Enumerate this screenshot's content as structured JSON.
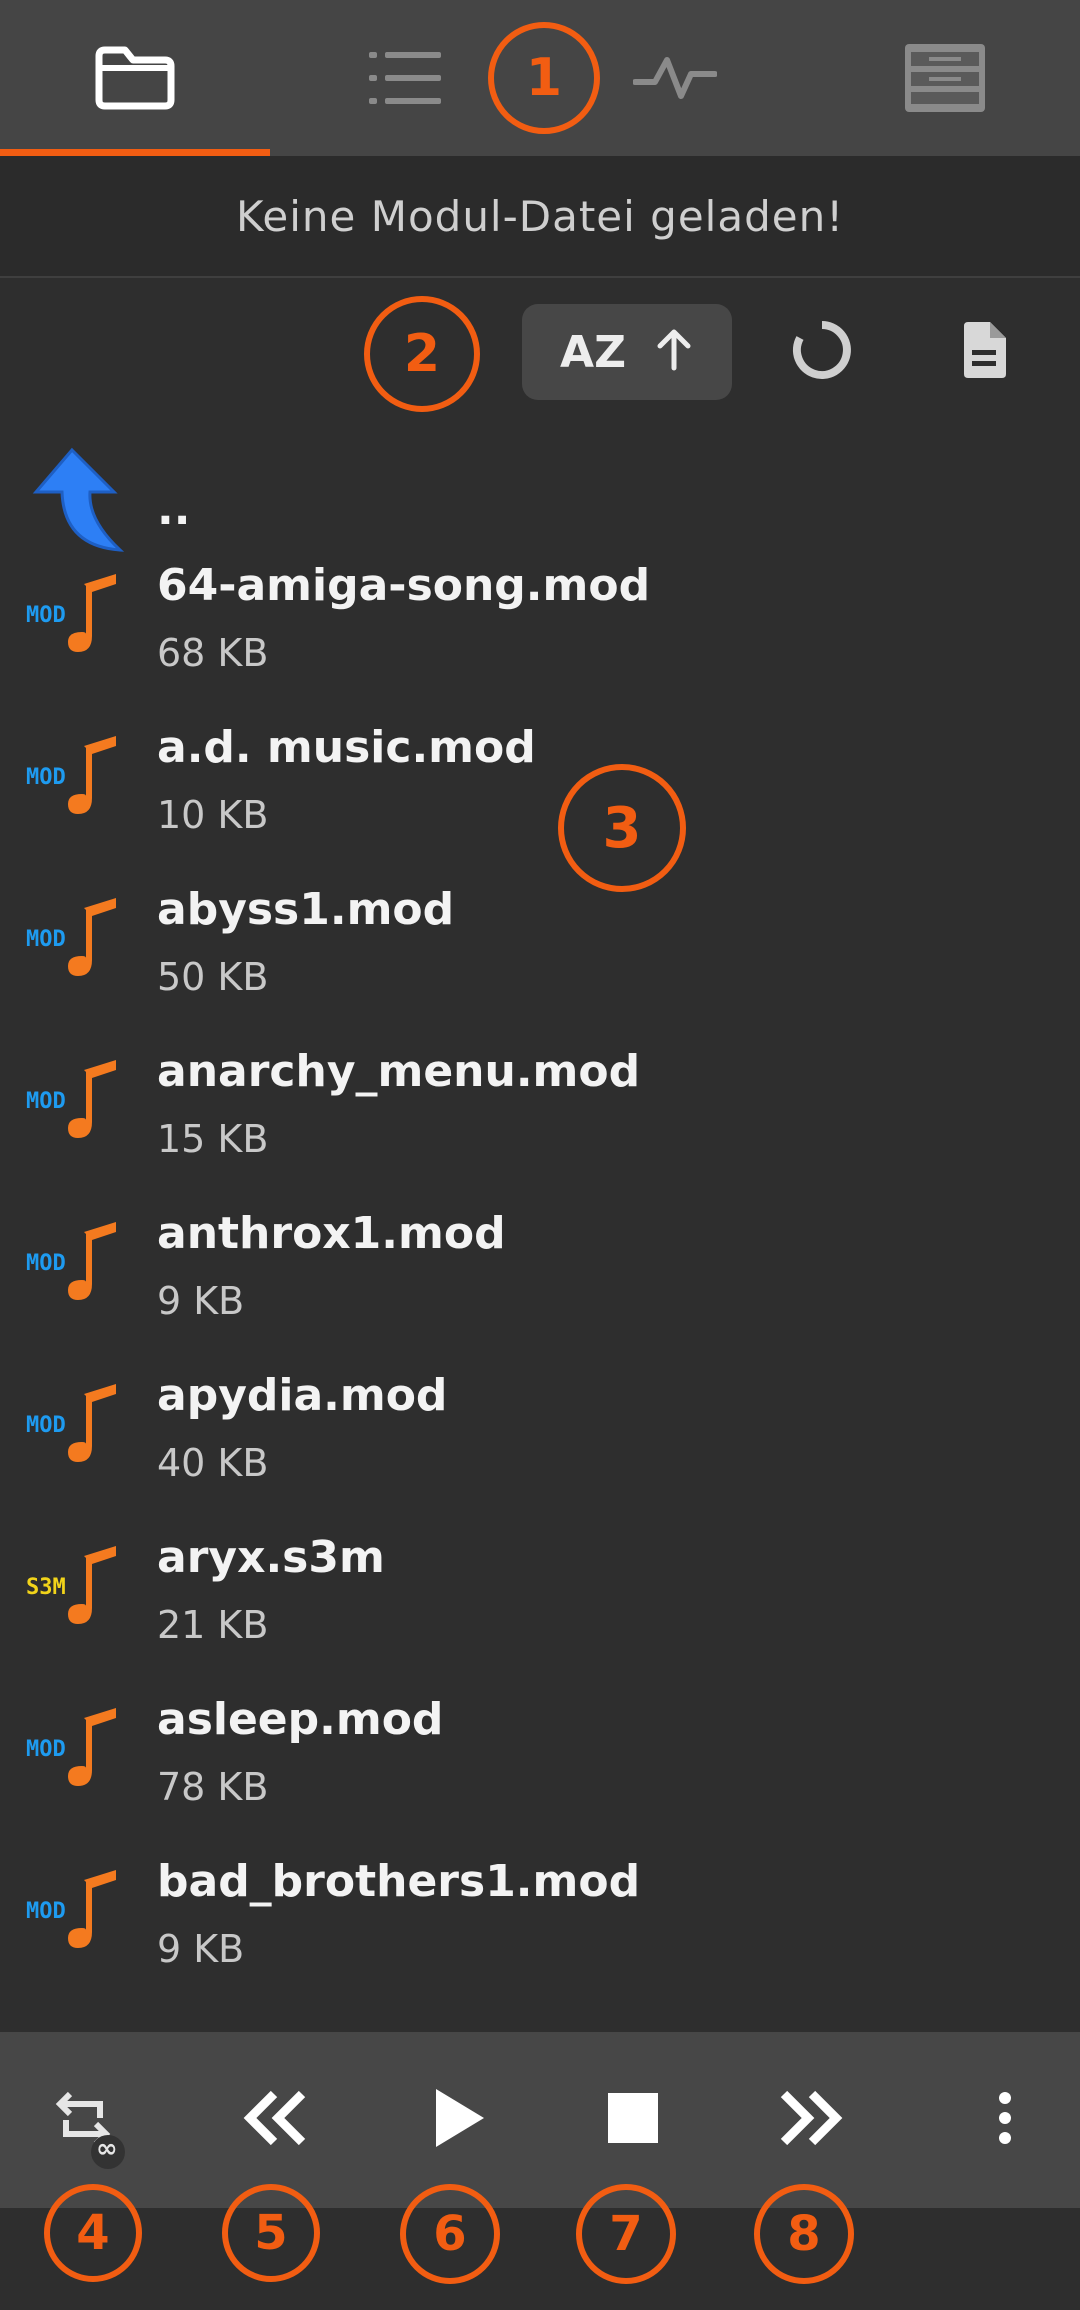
{
  "tabs": [
    {
      "name": "files",
      "icon": "folder-icon",
      "active": true
    },
    {
      "name": "playlist",
      "icon": "list-icon",
      "active": false
    },
    {
      "name": "visualizer",
      "icon": "waveform-icon",
      "active": false
    },
    {
      "name": "info",
      "icon": "module-info-icon",
      "active": false
    }
  ],
  "status": {
    "message": "Keine Modul-Datei geladen!"
  },
  "toolbar": {
    "sort": {
      "label": "AZ",
      "direction_icon": "arrow-up-icon"
    },
    "refresh_icon": "refresh-icon",
    "file_icon": "document-icon"
  },
  "files": [
    {
      "name": "..",
      "size": "",
      "type": "parent"
    },
    {
      "name": "64-amiga-song.mod",
      "size": "68 KB",
      "type": "mod"
    },
    {
      "name": "a.d. music.mod",
      "size": "10 KB",
      "type": "mod"
    },
    {
      "name": "abyss1.mod",
      "size": "50 KB",
      "type": "mod"
    },
    {
      "name": "anarchy_menu.mod",
      "size": "15 KB",
      "type": "mod"
    },
    {
      "name": "anthrox1.mod",
      "size": "9 KB",
      "type": "mod"
    },
    {
      "name": "apydia.mod",
      "size": "40 KB",
      "type": "mod"
    },
    {
      "name": "aryx.s3m",
      "size": "21 KB",
      "type": "s3m"
    },
    {
      "name": "asleep.mod",
      "size": "78 KB",
      "type": "mod"
    },
    {
      "name": "bad_brothers1.mod",
      "size": "9 KB",
      "type": "mod"
    }
  ],
  "file_badges": {
    "mod": "MOD",
    "s3m": "S3M"
  },
  "controls": {
    "repeat_badge": "∞",
    "buttons": [
      "repeat-icon",
      "rewind-icon",
      "play-icon",
      "stop-icon",
      "fast-forward-icon",
      "more-vert-icon"
    ]
  },
  "callouts": [
    "1",
    "2",
    "3",
    "4",
    "5",
    "6",
    "7",
    "8"
  ],
  "colors": {
    "accent": "#f25d12",
    "background": "#2e2e2e",
    "tabbar": "#454545",
    "mod_badge": "#1e9bf0",
    "s3m_badge": "#f2d41a",
    "note": "#f47a1f",
    "parent_arrow": "#2d7ff5"
  }
}
